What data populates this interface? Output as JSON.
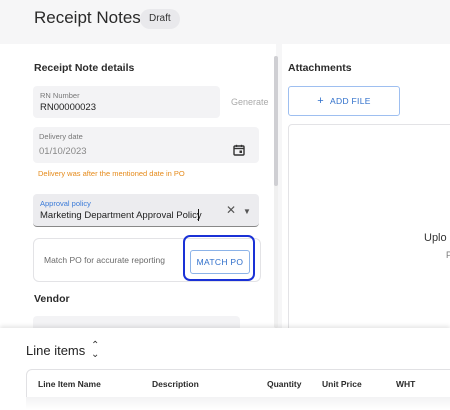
{
  "header": {
    "title": "Receipt Notes",
    "status_badge": "Draft"
  },
  "receipt_details": {
    "heading": "Receipt Note details",
    "rn_number": {
      "label": "RN Number",
      "value": "RN00000023",
      "generate_label": "Generate"
    },
    "delivery_date": {
      "label": "Delivery date",
      "value": "01/10/2023",
      "warning": "Delivery was after the mentioned date in PO"
    },
    "approval_policy": {
      "label": "Approval policy",
      "value": "Marketing Department Approval Policy"
    },
    "match_po": {
      "text": "Match PO for accurate reporting",
      "button_label": "MATCH PO"
    },
    "vendor_heading": "Vendor"
  },
  "attachments": {
    "heading": "Attachments",
    "add_file_label": "ADD FILE",
    "upload_text": "Uplo",
    "upload_sub": "P"
  },
  "line_items": {
    "title": "Line items",
    "columns": [
      "Line Item Name",
      "Description",
      "Quantity",
      "Unit Price",
      "WHT"
    ]
  },
  "icons": {
    "date": "calendar-icon",
    "clear": "close-icon",
    "dropdown": "chevron-down-icon",
    "add": "plus-icon",
    "sort": "sort-icon"
  },
  "colors": {
    "accent": "#2f6fcb",
    "warning": "#e58a1a",
    "highlight": "#1a31d6"
  }
}
